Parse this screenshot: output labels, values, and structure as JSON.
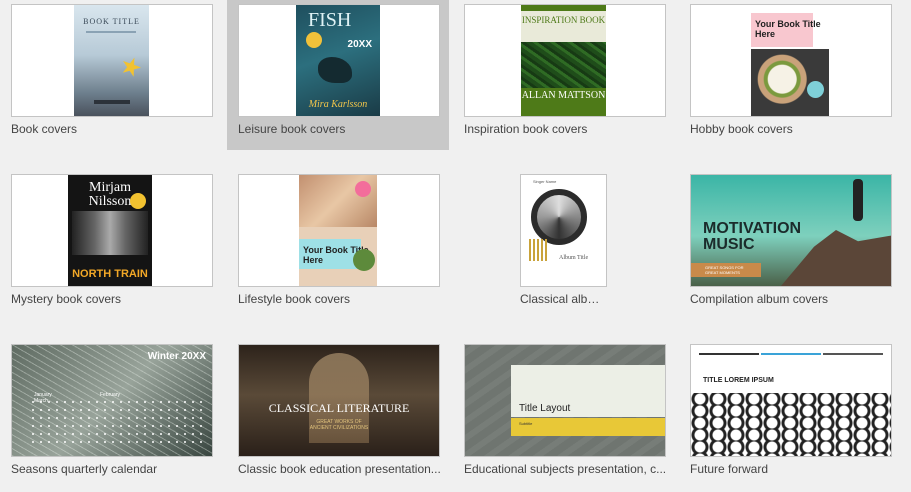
{
  "templates": [
    {
      "label": "Book covers",
      "cover": {
        "title": "BOOK TITLE"
      }
    },
    {
      "label": "Leisure book covers",
      "cover": {
        "title": "FISH",
        "year": "20XX",
        "author": "Mira Karlsson"
      }
    },
    {
      "label": "Inspiration book covers",
      "cover": {
        "title": "INSPIRATION BOOK",
        "author": "ALLAN MATTSON"
      }
    },
    {
      "label": "Hobby book covers",
      "cover": {
        "title": "Your Book Title Here"
      }
    },
    {
      "label": "Mystery book covers",
      "cover": {
        "title": "Mirjam Nilsson",
        "subtitle": "NORTH TRAIN"
      }
    },
    {
      "label": "Lifestyle book covers",
      "cover": {
        "title": "Your Book Title Here"
      }
    },
    {
      "label": "Classical albu...",
      "cover": {
        "title": "Album Title",
        "header": "Singer Name"
      }
    },
    {
      "label": "Compilation album covers",
      "cover": {
        "title": "MOTIVATION MUSIC",
        "tag": "GREAT SONGS FOR GREAT MOMENTS"
      }
    },
    {
      "label": "Seasons quarterly calendar",
      "cover": {
        "title": "Winter 20XX",
        "months": [
          "January",
          "February",
          "March"
        ]
      }
    },
    {
      "label": "Classic book education presentation...",
      "cover": {
        "title": "CLASSICAL LITERATURE",
        "subtitle": "GREAT WORKS OF ANCIENT CIVILIZATIONS"
      }
    },
    {
      "label": "Educational subjects presentation, c...",
      "cover": {
        "title": "Title Layout",
        "subtitle": "Subtitle"
      }
    },
    {
      "label": "Future forward",
      "cover": {
        "title": "TITLE LOREM IPSUM"
      }
    }
  ],
  "selected_index": 1
}
